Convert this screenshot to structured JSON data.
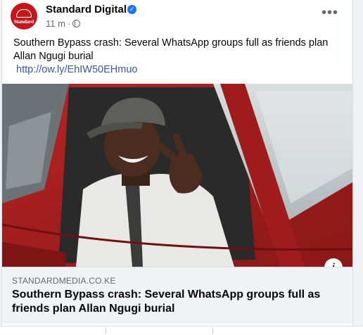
{
  "post": {
    "page_name": "Standard Digital",
    "avatar_text": "Standard",
    "timestamp": "11 m",
    "separator": "·",
    "message": "Southern Bypass crash: Several WhatsApp groups full as friends plan Allan Ngugi burial",
    "link_url": "http://ow.ly/EhIW50EHmuo",
    "more_label": "•••",
    "verified_glyph": "✓"
  },
  "link_preview": {
    "domain": "STANDARDMEDIA.CO.KE",
    "title": "Southern Bypass crash: Several WhatsApp groups full as friends plan Allan Ngugi burial",
    "info_label": "i"
  },
  "colors": {
    "brand_red": "#c4171c",
    "link_blue": "#385898",
    "verified_blue": "#1877f2",
    "car_red": "#a61d1d"
  },
  "icons": [
    "avatar-logo",
    "verified-badge-icon",
    "globe-icon",
    "more-options-icon",
    "info-icon"
  ]
}
